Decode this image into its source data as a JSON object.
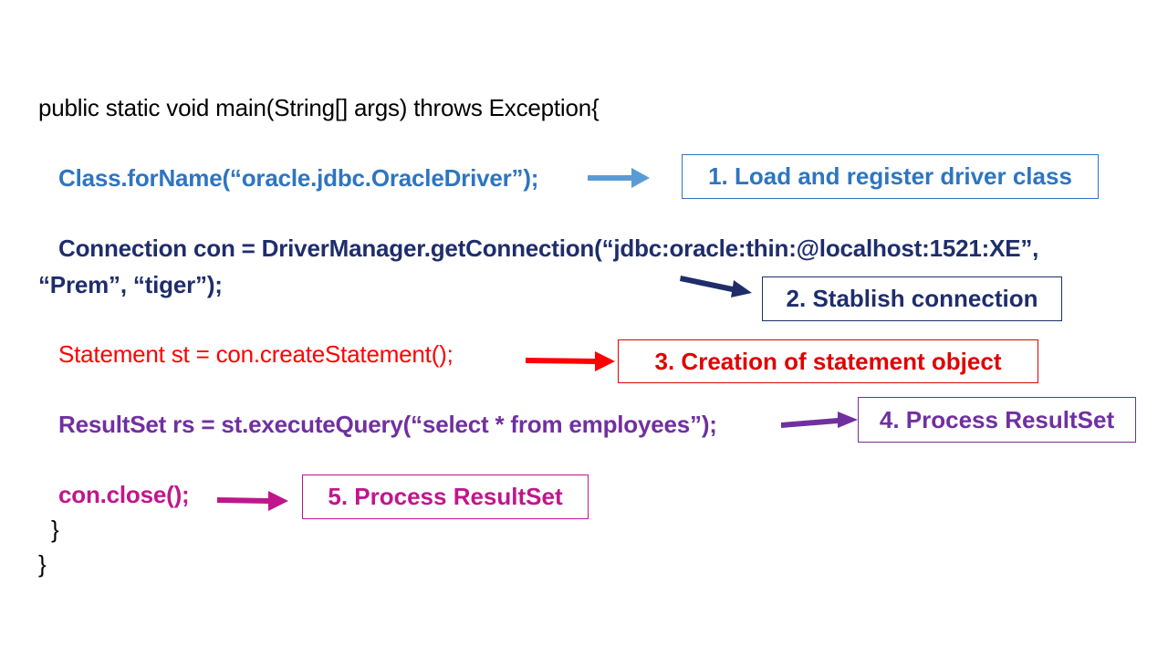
{
  "colors": {
    "black": "#000000",
    "step1": "#2e75c0",
    "step1_arrow": "#5b9bd5",
    "step1_border": "#2e75c0",
    "step2": "#1f2d6b",
    "step2_border": "#1f2d6b",
    "step3": "#ff0000",
    "step3_border": "#e00000",
    "step4": "#7030a0",
    "step4_border": "#7030a0",
    "step5": "#c0168c",
    "step5_arrow": "#c0168c",
    "step5_border": "#c0168c"
  },
  "code": {
    "line_main": "public static void main(String[] args) throws Exception{",
    "line_class_forname": "Class.forName(“oracle.jdbc.OracleDriver”);",
    "line_connection_1": "Connection con = DriverManager.getConnection(“jdbc:oracle:thin:@localhost:1521:XE”,",
    "line_connection_2": "“Prem”, “tiger”);",
    "line_statement": "Statement st = con.createStatement();",
    "line_resultset": "ResultSet rs = st.executeQuery(“select * from employees”);",
    "line_close": "con.close();",
    "close_brace_inner": "}",
    "close_brace_outer": "}"
  },
  "steps": [
    {
      "label": "1. Load and register driver class",
      "arrow_icon": "arrow-right-icon"
    },
    {
      "label": "2. Stablish connection",
      "arrow_icon": "arrow-right-icon"
    },
    {
      "label": "3. Creation of statement object",
      "arrow_icon": "arrow-right-icon"
    },
    {
      "label": "4.  Process ResultSet",
      "arrow_icon": "arrow-right-icon"
    },
    {
      "label": "5. Process ResultSet",
      "arrow_icon": "arrow-right-icon"
    }
  ]
}
